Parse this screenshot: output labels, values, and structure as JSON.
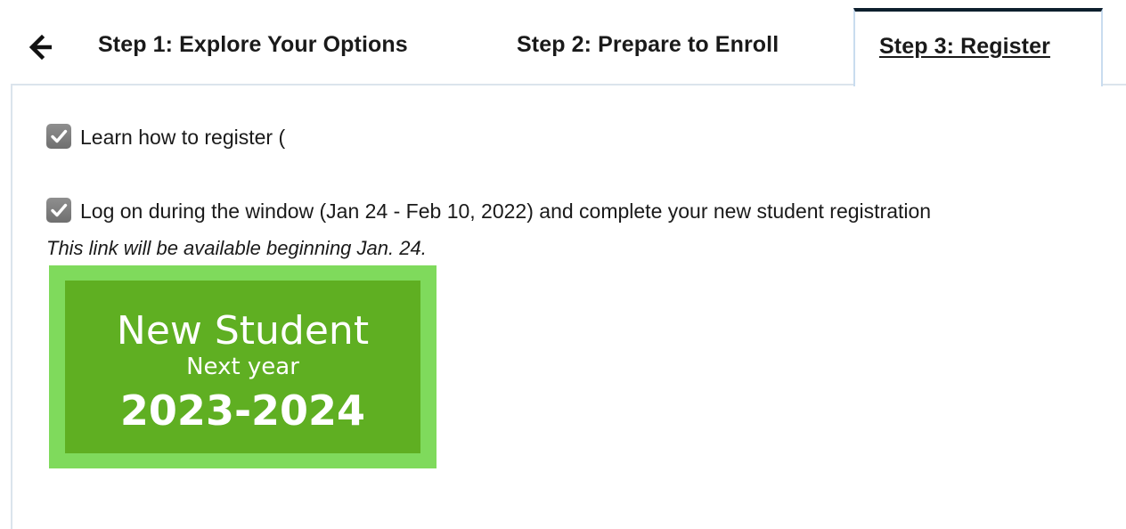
{
  "nav": {
    "back_icon": "arrow-left-icon",
    "tabs": [
      {
        "label": "Step 1: Explore Your Options"
      },
      {
        "label": "Step 2: Prepare to Enroll"
      },
      {
        "label": "Step 3: Register",
        "active": true
      }
    ]
  },
  "content": {
    "tasks": [
      {
        "label": "Learn how to register (",
        "checked": true
      },
      {
        "label": "Log on during the window (Jan 24 - Feb 10, 2022) and complete your new student registration",
        "checked": true
      }
    ],
    "note": "This link will be available beginning Jan. 24.",
    "banner": {
      "title": "New Student",
      "subtitle": "Next year",
      "years": "2023-2024",
      "colors": {
        "outer": "#7fda5c",
        "inner": "#5faf22",
        "text": "#ffffff"
      }
    }
  }
}
